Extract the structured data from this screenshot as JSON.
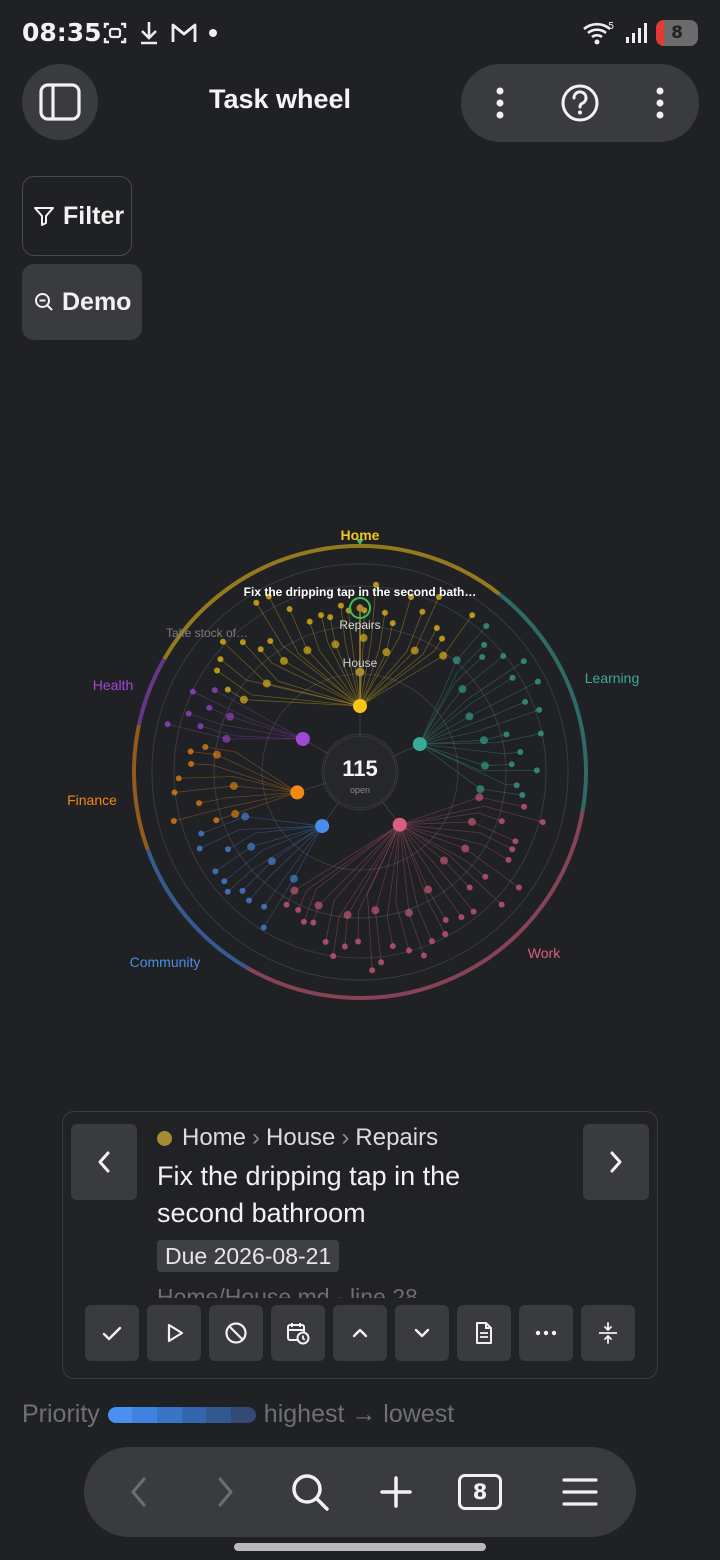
{
  "status": {
    "time": "08:35",
    "battery": "8",
    "wifi_badge": "5"
  },
  "header": {
    "title": "Task wheel"
  },
  "controls": {
    "filter_label": "Filter",
    "demo_label": "Demo"
  },
  "wheel": {
    "center_count": "115",
    "center_label": "open",
    "areas": [
      {
        "name": "Home",
        "color": "#f5c518"
      },
      {
        "name": "Learning",
        "color": "#3aaa99"
      },
      {
        "name": "Work",
        "color": "#d9607f"
      },
      {
        "name": "Community",
        "color": "#4a8de8"
      },
      {
        "name": "Finance",
        "color": "#f08a14"
      },
      {
        "name": "Health",
        "color": "#a048d6"
      }
    ],
    "labels": {
      "selected_task": "Fix the dripping tap in the second bath…",
      "branch_repairs": "Repairs",
      "branch_house": "House",
      "dim_task": "Take stock of…"
    }
  },
  "card": {
    "breadcrumb": [
      "Home",
      "House",
      "Repairs"
    ],
    "breadcrumb_color": "#a68b33",
    "title": "Fix the dripping tap in the second bathroom",
    "due": "Due 2026-08-21",
    "file_ref": "Home/House.md · line 28"
  },
  "legend": {
    "label": "Priority",
    "range": "highest → lowest",
    "colors": [
      "#4a90f0",
      "#3f82e0",
      "#3874c8",
      "#3366ad",
      "#33588f",
      "#334a74"
    ]
  },
  "bottom_nav": {
    "tabs": "8"
  }
}
